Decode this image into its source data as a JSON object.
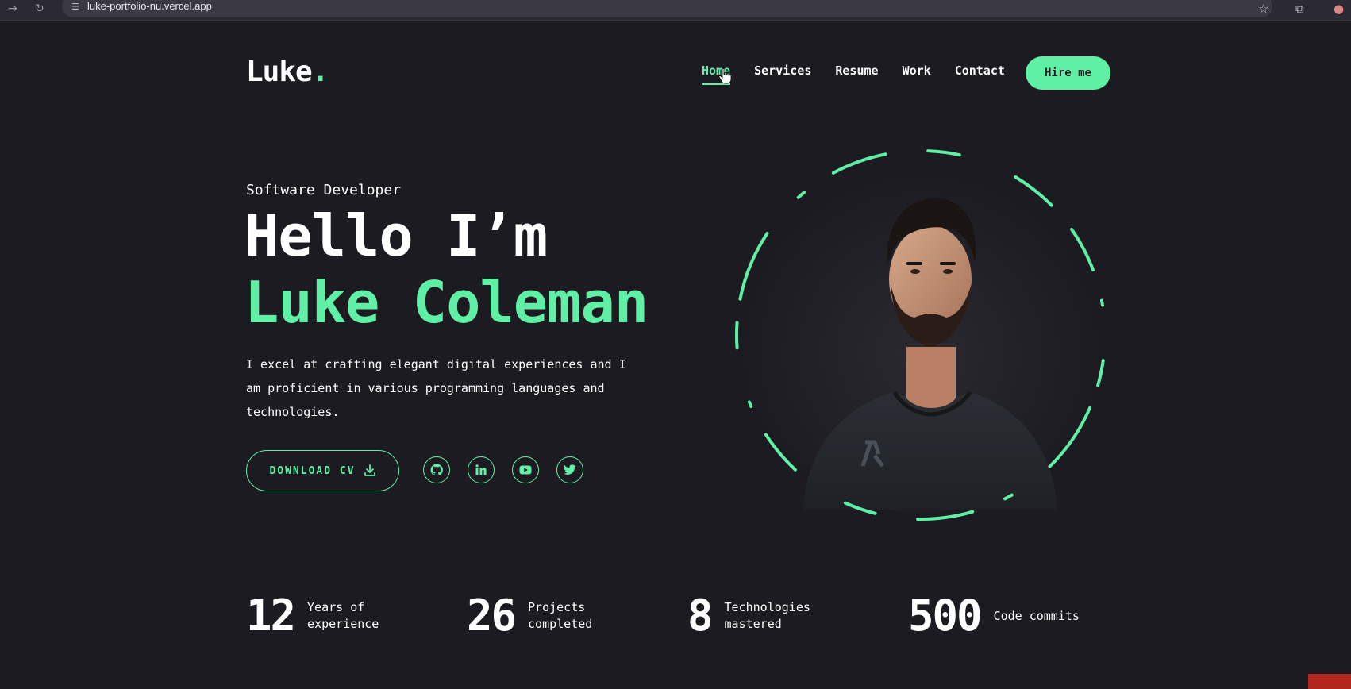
{
  "browser": {
    "url": "luke-portfolio-nu.vercel.app",
    "icons": [
      "back-icon",
      "reload-icon",
      "site-settings-icon",
      "bookmark-star-icon",
      "extensions-icon",
      "profile-avatar-icon"
    ]
  },
  "header": {
    "logo_text": "Luke",
    "logo_dot": ".",
    "nav": [
      {
        "label": "Home",
        "active": true
      },
      {
        "label": "Services",
        "active": false
      },
      {
        "label": "Resume",
        "active": false
      },
      {
        "label": "Work",
        "active": false
      },
      {
        "label": "Contact",
        "active": false
      }
    ],
    "hire_label": "Hire me"
  },
  "hero": {
    "subtitle": "Software Developer",
    "greeting": "Hello I’m",
    "name": "Luke Coleman",
    "description": "I excel at crafting elegant digital experiences and I am proficient in various programming languages and technologies.",
    "download_label": "DOWNLOAD CV",
    "socials": [
      {
        "name": "github",
        "icon": "github-icon"
      },
      {
        "name": "linkedin",
        "icon": "linkedin-icon"
      },
      {
        "name": "youtube",
        "icon": "youtube-icon"
      },
      {
        "name": "twitter",
        "icon": "twitter-icon"
      }
    ]
  },
  "stats": [
    {
      "number": "12",
      "label": "Years of experience"
    },
    {
      "number": "26",
      "label": "Projects completed"
    },
    {
      "number": "8",
      "label": "Technologies mastered"
    },
    {
      "number": "500",
      "label": "Code commits"
    }
  ],
  "colors": {
    "background": "#1c1b22",
    "accent": "#5ff0a5",
    "text": "#ffffff"
  }
}
